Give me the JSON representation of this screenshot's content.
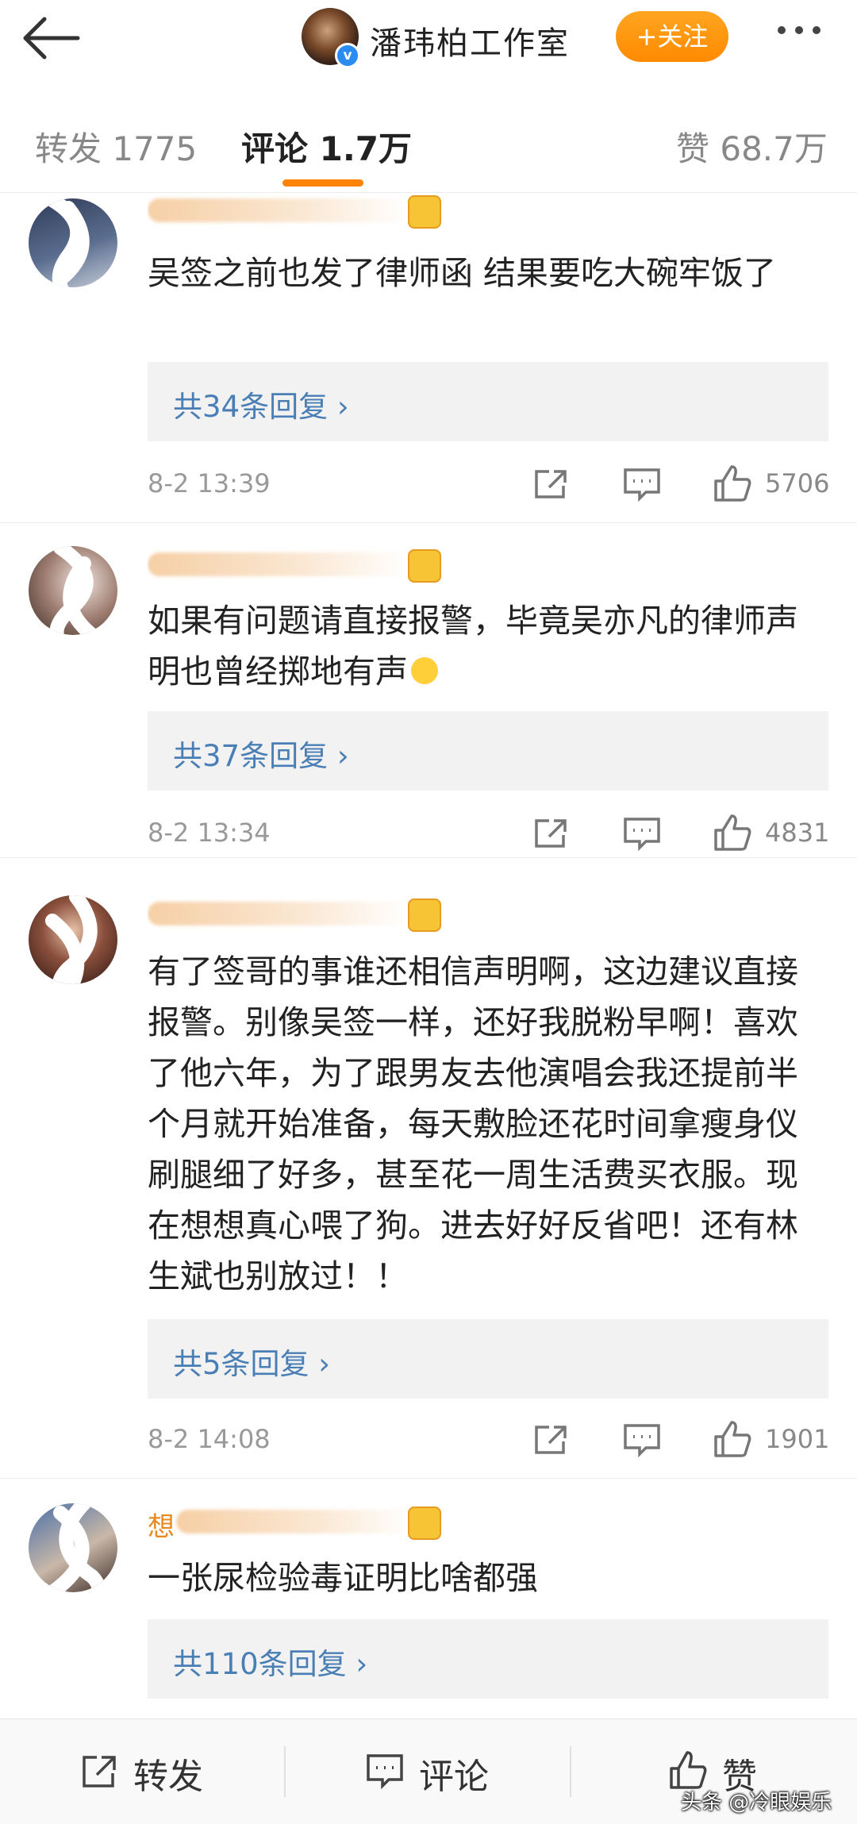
{
  "header": {
    "back_icon": "back-arrow-icon",
    "title": "潘玮柏工作室",
    "follow_label": "+关注",
    "more_icon": "more-dots-icon",
    "verified_mark": "v"
  },
  "tabs": {
    "repost": "转发 1775",
    "comment": "评论 1.7万",
    "like": "赞 68.7万"
  },
  "colors": {
    "accent": "#ff8200",
    "name": "#e88a24",
    "link": "#4a7fb5"
  },
  "comments": [
    {
      "text": "吴签之前也发了律师函 结果要吃大碗牢饭了",
      "replies": "共34条回复 ›",
      "time": "8-2 13:39",
      "likes": "5706"
    },
    {
      "text": "如果有问题请直接报警，毕竟吴亦凡的律师声明也曾经掷地有声",
      "emoji": "emoji-face-icon",
      "replies": "共37条回复 ›",
      "time": "8-2 13:34",
      "likes": "4831"
    },
    {
      "text": "有了签哥的事谁还相信声明啊，这边建议直接报警。别像吴签一样，还好我脱粉早啊！喜欢了他六年，为了跟男友去他演唱会我还提前半个月就开始准备，每天敷脸还花时间拿瘦身仪刷腿细了好多，甚至花一周生活费买衣服。现在想想真心喂了狗。进去好好反省吧！还有林生斌也别放过！！",
      "replies": "共5条回复 ›",
      "time": "8-2 14:08",
      "likes": "1901"
    },
    {
      "name": "想",
      "text": "一张尿检验毒证明比啥都强",
      "replies": "共110条回复 ›"
    }
  ],
  "bottom_bar": {
    "repost": "转发",
    "comment": "评论",
    "like": "赞"
  },
  "watermark": "头条 @冷眼娱乐"
}
